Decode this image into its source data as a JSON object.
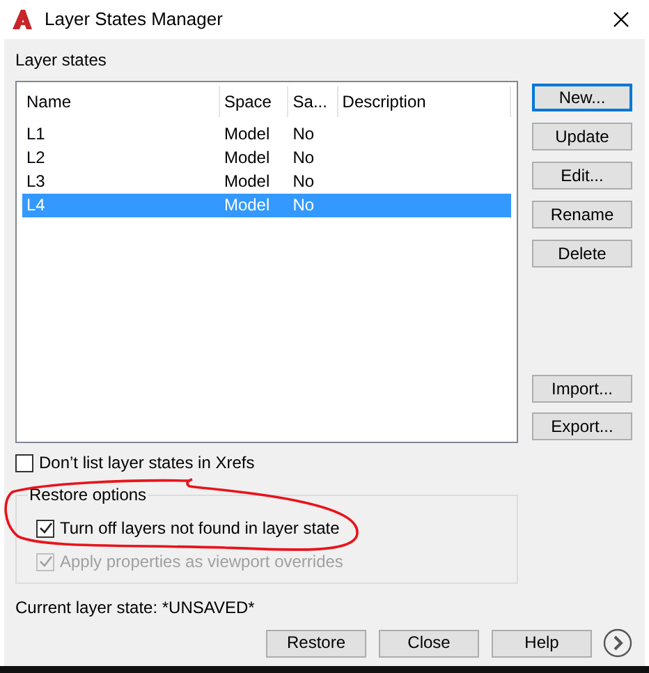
{
  "window": {
    "title": "Layer States Manager"
  },
  "layer_states": {
    "label": "Layer states",
    "columns": [
      "Name",
      "Space",
      "Sa...",
      "Description"
    ],
    "rows": [
      {
        "cells": [
          "L1",
          "Model",
          "No",
          ""
        ],
        "selected": false
      },
      {
        "cells": [
          "L2",
          "Model",
          "No",
          ""
        ],
        "selected": false
      },
      {
        "cells": [
          "L3",
          "Model",
          "No",
          ""
        ],
        "selected": false
      },
      {
        "cells": [
          "L4",
          "Model",
          "No",
          ""
        ],
        "selected": true
      }
    ]
  },
  "side_buttons": [
    {
      "label": "New...",
      "focused": true
    },
    {
      "label": "Update",
      "focused": false
    },
    {
      "label": "Edit...",
      "focused": false
    },
    {
      "label": "Rename",
      "focused": false
    },
    {
      "label": "Delete",
      "focused": false
    }
  ],
  "side_buttons_lower": [
    {
      "label": "Import..."
    },
    {
      "label": "Export..."
    }
  ],
  "xref_checkbox": {
    "label": "Don’t list layer states in Xrefs",
    "checked": false,
    "disabled": false
  },
  "restore_options": {
    "label": "Restore options",
    "options": [
      {
        "label": "Turn off layers not found in layer state",
        "checked": true,
        "disabled": false
      },
      {
        "label": "Apply properties as viewport overrides",
        "checked": true,
        "disabled": true
      }
    ]
  },
  "current_state": "Current layer state: *UNSAVED*",
  "footer_buttons": [
    "Restore",
    "Close",
    "Help"
  ]
}
